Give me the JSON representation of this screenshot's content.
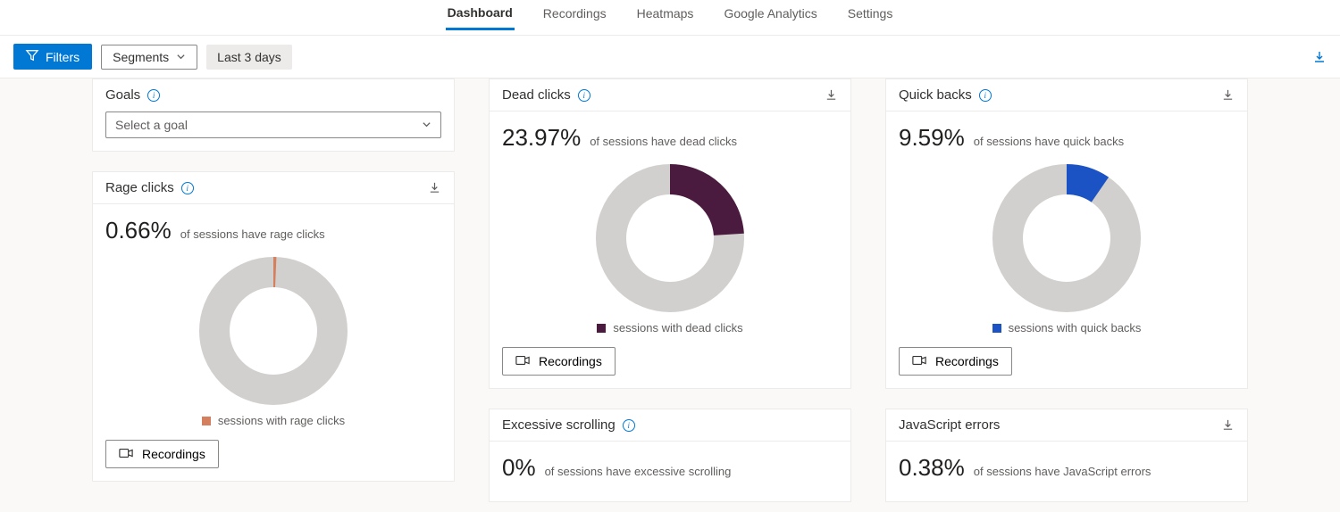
{
  "nav": {
    "tabs": [
      "Dashboard",
      "Recordings",
      "Heatmaps",
      "Google Analytics",
      "Settings"
    ],
    "active": "Dashboard"
  },
  "toolbar": {
    "filters_label": "Filters",
    "segments_label": "Segments",
    "date_range_label": "Last 3 days"
  },
  "goals": {
    "title": "Goals",
    "placeholder": "Select a goal"
  },
  "cards": {
    "rage": {
      "title": "Rage clicks",
      "value": "0.66%",
      "desc": "of sessions have rage clicks",
      "legend": "sessions with rage clicks",
      "color": "#d47f5e",
      "recordings_label": "Recordings"
    },
    "dead": {
      "title": "Dead clicks",
      "value": "23.97%",
      "desc": "of sessions have dead clicks",
      "legend": "sessions with dead clicks",
      "color": "#4b1a3f",
      "recordings_label": "Recordings"
    },
    "quick": {
      "title": "Quick backs",
      "value": "9.59%",
      "desc": "of sessions have quick backs",
      "legend": "sessions with quick backs",
      "color": "#1b52c4",
      "recordings_label": "Recordings"
    },
    "scroll": {
      "title": "Excessive scrolling",
      "value": "0%",
      "desc": "of sessions have excessive scrolling"
    },
    "jserr": {
      "title": "JavaScript errors",
      "value": "0.38%",
      "desc": "of sessions have JavaScript errors"
    }
  },
  "chart_data": [
    {
      "type": "pie",
      "card": "rage",
      "title": "Rage clicks",
      "series": [
        {
          "name": "sessions with rage clicks",
          "value": 0.66,
          "color": "#d47f5e"
        },
        {
          "name": "other",
          "value": 99.34,
          "color": "#d2d0ce"
        }
      ]
    },
    {
      "type": "pie",
      "card": "dead",
      "title": "Dead clicks",
      "series": [
        {
          "name": "sessions with dead clicks",
          "value": 23.97,
          "color": "#4b1a3f"
        },
        {
          "name": "other",
          "value": 76.03,
          "color": "#d2d0ce"
        }
      ]
    },
    {
      "type": "pie",
      "card": "quick",
      "title": "Quick backs",
      "series": [
        {
          "name": "sessions with quick backs",
          "value": 9.59,
          "color": "#1b52c4"
        },
        {
          "name": "other",
          "value": 90.41,
          "color": "#d2d0ce"
        }
      ]
    }
  ]
}
